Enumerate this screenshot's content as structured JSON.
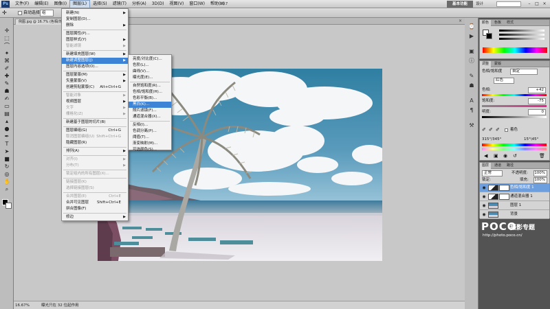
{
  "app": {
    "logo": "Ps",
    "essentials": "基本功能",
    "workspace_label": "设计",
    "zoom_display": "16.7",
    "window_buttons": [
      "–",
      "□",
      "×"
    ]
  },
  "menubar": {
    "items": [
      "文件(F)",
      "编辑(E)",
      "图像(I)",
      "图层(L)",
      "选择(S)",
      "滤镜(T)",
      "分析(A)",
      "3D(D)",
      "视图(V)",
      "窗口(W)",
      "帮助(H)"
    ],
    "active_index": 3
  },
  "options": {
    "auto_select_label": "自动选择:",
    "auto_select_value": "组",
    "transform_label": "显示变换控件"
  },
  "document": {
    "tab_label": "例图.jpg @ 16.7% (色相/饱和...",
    "status_zoom": "16.67%",
    "status_text": "曝光只在 32 位起作用"
  },
  "layer_menu": {
    "items": [
      {
        "label": "新建(N)",
        "arrow": true
      },
      {
        "label": "复制图层(D)..."
      },
      {
        "label": "删除",
        "arrow": true
      },
      {
        "sep": true
      },
      {
        "label": "图层属性(P)..."
      },
      {
        "label": "图层样式(Y)",
        "arrow": true
      },
      {
        "label": "智能滤镜",
        "arrow": true,
        "disabled": true
      },
      {
        "sep": true
      },
      {
        "label": "新建填充图层(W)",
        "arrow": true
      },
      {
        "label": "新建调整图层(J)",
        "arrow": true,
        "highlight": true
      },
      {
        "label": "图层内容选项(O)..."
      },
      {
        "sep": true
      },
      {
        "label": "图层蒙版(M)",
        "arrow": true
      },
      {
        "label": "矢量蒙版(V)",
        "arrow": true
      },
      {
        "label": "创建剪贴蒙版(C)",
        "shortcut": "Alt+Ctrl+G"
      },
      {
        "sep": true
      },
      {
        "label": "智能对象",
        "arrow": true,
        "disabled": true
      },
      {
        "label": "视频图层",
        "arrow": true
      },
      {
        "label": "文字",
        "arrow": true,
        "disabled": true
      },
      {
        "label": "栅格化(Z)",
        "arrow": true,
        "disabled": true
      },
      {
        "sep": true
      },
      {
        "label": "新建基于图层的切片(B)"
      },
      {
        "sep": true
      },
      {
        "label": "图层编组(G)",
        "shortcut": "Ctrl+G"
      },
      {
        "label": "取消图层编组(U)",
        "shortcut": "Shift+Ctrl+G",
        "disabled": true
      },
      {
        "label": "隐藏图层(R)"
      },
      {
        "sep": true
      },
      {
        "label": "排列(A)",
        "arrow": true
      },
      {
        "sep": true
      },
      {
        "label": "对齐(I)",
        "arrow": true,
        "disabled": true
      },
      {
        "label": "分布(T)",
        "arrow": true,
        "disabled": true
      },
      {
        "sep": true
      },
      {
        "label": "锁定组内的所有图层(X)...",
        "disabled": true
      },
      {
        "sep": true
      },
      {
        "label": "链接图层(K)",
        "disabled": true
      },
      {
        "label": "选择链接图层(S)",
        "disabled": true
      },
      {
        "sep": true
      },
      {
        "label": "合并图层(E)",
        "shortcut": "Ctrl+E",
        "disabled": true
      },
      {
        "label": "合并可见图层",
        "shortcut": "Shift+Ctrl+E"
      },
      {
        "label": "拼合图像(F)"
      },
      {
        "sep": true
      },
      {
        "label": "修边",
        "arrow": true
      }
    ]
  },
  "adjust_menu": {
    "items": [
      {
        "label": "亮度/对比度(C)..."
      },
      {
        "label": "色阶(L)..."
      },
      {
        "label": "曲线(V)..."
      },
      {
        "label": "曝光度(E)..."
      },
      {
        "sep": true
      },
      {
        "label": "自然饱和度(R)..."
      },
      {
        "label": "色相/饱和度(H)..."
      },
      {
        "label": "色彩平衡(B)..."
      },
      {
        "label": "黑白(K)...",
        "highlight": true
      },
      {
        "label": "照片滤镜(F)..."
      },
      {
        "label": "通道混合器(X)..."
      },
      {
        "sep": true
      },
      {
        "label": "反相(I)..."
      },
      {
        "label": "色调分离(P)..."
      },
      {
        "label": "阈值(T)..."
      },
      {
        "label": "渐变映射(M)..."
      },
      {
        "label": "可选颜色(S)..."
      }
    ]
  },
  "adjustments_panel": {
    "tabs": [
      "调整",
      "蒙版"
    ],
    "title": "色相/饱和度",
    "preset_label": "自定",
    "channel": "红色",
    "hue_label": "色相:",
    "hue_value": "+42",
    "saturation_label": "饱和度:",
    "saturation_value": "-75",
    "lightness_label": "明度:",
    "lightness_value": "0",
    "colorize_label": "着色",
    "range_left": "315°/345°",
    "range_right": "15°\\45°"
  },
  "color_panel": {
    "tabs": [
      "颜色",
      "色板",
      "样式"
    ]
  },
  "layers_panel": {
    "tabs": [
      "图层",
      "通道",
      "路径"
    ],
    "blend_mode": "正常",
    "opacity_label": "不透明度:",
    "opacity_value": "100%",
    "lock_label": "锁定:",
    "fill_label": "填充:",
    "fill_value": "100%",
    "layers": [
      {
        "name": "色相/饱和度 1",
        "type": "adjustment",
        "selected": true
      },
      {
        "name": "通道混合器 1",
        "type": "adjustment",
        "selected": false
      },
      {
        "name": "图层 1",
        "type": "image",
        "selected": false
      },
      {
        "name": "背景",
        "type": "image",
        "selected": false
      }
    ]
  },
  "watermark": {
    "brand": "POCO",
    "title": "摄影专题",
    "url": "http://photo.poco.cn/"
  },
  "colors": {
    "highlight": "#3e84d6",
    "panel_bg": "#d4d4d4",
    "workspace_bg": "#c8c8c8"
  }
}
